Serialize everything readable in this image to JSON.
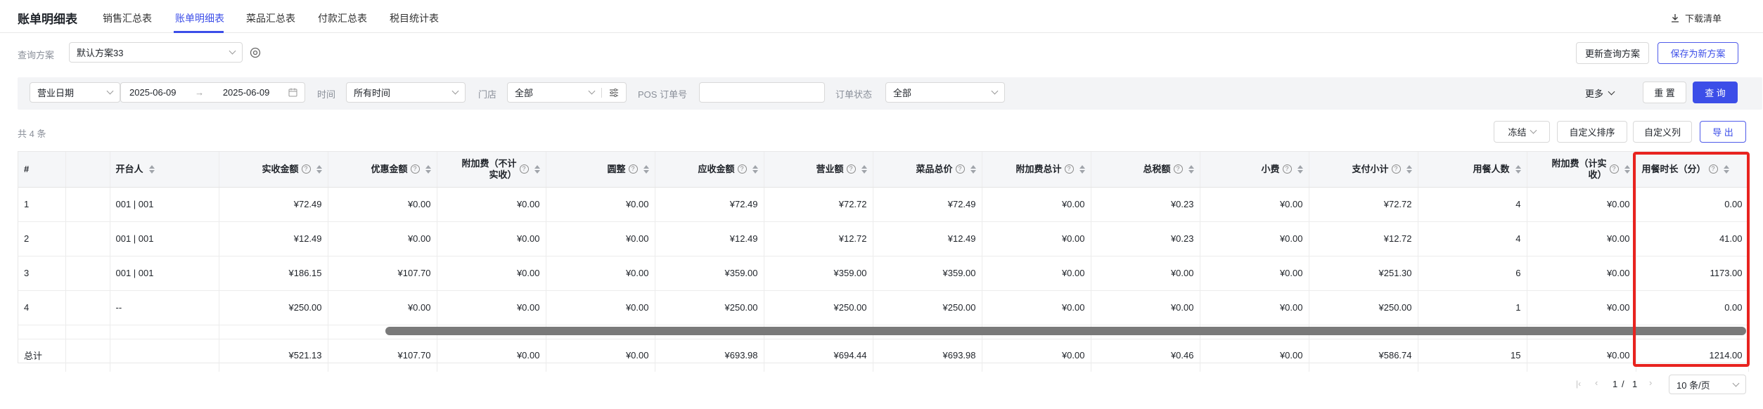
{
  "header": {
    "title": "账单明细表",
    "tabs": [
      "销售汇总表",
      "账单明细表",
      "菜品汇总表",
      "付款汇总表",
      "税目统计表"
    ],
    "active_tab": 1,
    "download_label": "下载清单"
  },
  "scheme": {
    "label": "查询方案",
    "value": "默认方案33",
    "update_button": "更新查询方案",
    "save_new_button": "保存为新方案"
  },
  "filters": {
    "date_type": "营业日期",
    "date_start": "2025-06-09",
    "date_end": "2025-06-09",
    "time_label": "时间",
    "time_value": "所有时间",
    "store_label": "门店",
    "store_value": "全部",
    "pos_label": "POS 订单号",
    "pos_value": "",
    "status_label": "订单状态",
    "status_value": "全部",
    "more_label": "更多",
    "reset_button": "重 置",
    "query_button": "查 询"
  },
  "toolbar": {
    "count_text": "共 4 条",
    "freeze_button": "冻结",
    "custom_sort_button": "自定义排序",
    "custom_columns_button": "自定义列",
    "export_button": "导 出"
  },
  "table": {
    "headers": [
      "#",
      "",
      "开台人",
      "实收金额",
      "优惠金额",
      "附加费（不计实收）",
      "圆整",
      "应收金额",
      "营业额",
      "菜品总价",
      "附加费总计",
      "总税额",
      "小费",
      "支付小计",
      "用餐人数",
      "附加费（计实收）",
      "用餐时长（分）"
    ],
    "rows": [
      [
        "1",
        "",
        "001 | 001",
        "¥72.49",
        "¥0.00",
        "¥0.00",
        "¥0.00",
        "¥72.49",
        "¥72.72",
        "¥72.49",
        "¥0.00",
        "¥0.23",
        "¥0.00",
        "¥72.72",
        "4",
        "¥0.00",
        "0.00"
      ],
      [
        "2",
        "",
        "001 | 001",
        "¥12.49",
        "¥0.00",
        "¥0.00",
        "¥0.00",
        "¥12.49",
        "¥12.72",
        "¥12.49",
        "¥0.00",
        "¥0.23",
        "¥0.00",
        "¥12.72",
        "4",
        "¥0.00",
        "41.00"
      ],
      [
        "3",
        "",
        "001 | 001",
        "¥186.15",
        "¥107.70",
        "¥0.00",
        "¥0.00",
        "¥359.00",
        "¥359.00",
        "¥359.00",
        "¥0.00",
        "¥0.00",
        "¥0.00",
        "¥251.30",
        "6",
        "¥0.00",
        "1173.00"
      ],
      [
        "4",
        "",
        "--",
        "¥250.00",
        "¥0.00",
        "¥0.00",
        "¥0.00",
        "¥250.00",
        "¥250.00",
        "¥250.00",
        "¥0.00",
        "¥0.00",
        "¥0.00",
        "¥250.00",
        "1",
        "¥0.00",
        "0.00"
      ]
    ],
    "total": [
      "总计",
      "",
      "",
      "¥521.13",
      "¥107.70",
      "¥0.00",
      "¥0.00",
      "¥693.98",
      "¥694.44",
      "¥693.98",
      "¥0.00",
      "¥0.46",
      "¥0.00",
      "¥586.74",
      "15",
      "¥0.00",
      "1214.00"
    ]
  },
  "pagination": {
    "current": "1",
    "separator": "/",
    "total_pages": "1",
    "page_size": "10 条/页"
  }
}
